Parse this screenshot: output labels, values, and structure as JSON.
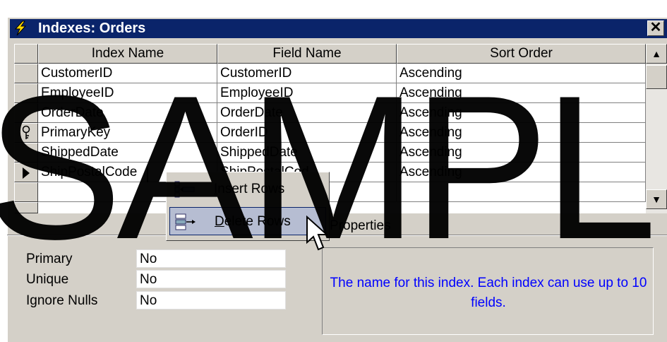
{
  "window": {
    "title": "Indexes: Orders",
    "close_glyph": "✕"
  },
  "grid": {
    "headers": [
      "Index Name",
      "Field Name",
      "Sort Order"
    ],
    "rows": [
      {
        "index": "CustomerID",
        "field": "CustomerID",
        "sort": "Ascending"
      },
      {
        "index": "EmployeeID",
        "field": "EmployeeID",
        "sort": "Ascending"
      },
      {
        "index": "OrderDate",
        "field": "OrderDate",
        "sort": "Ascending"
      },
      {
        "index": "PrimaryKey",
        "field": "OrderID",
        "sort": "Ascending"
      },
      {
        "index": "ShippedDate",
        "field": "ShippedDate",
        "sort": "Ascending"
      },
      {
        "index": "ShipPostalCode",
        "field": "ShipPostalCod",
        "sort": "Ascending"
      }
    ]
  },
  "context_menu": {
    "insert_first": "I",
    "insert_rest": "nsert Rows",
    "delete_first": "D",
    "delete_rest": "elete Rows"
  },
  "properties": {
    "section_label": "Properties",
    "items": [
      {
        "label": "Primary",
        "value": "No"
      },
      {
        "label": "Unique",
        "value": "No"
      },
      {
        "label": "Ignore Nulls",
        "value": "No"
      }
    ],
    "help_text": "The name for this index.  Each index can use up to 10 fields."
  },
  "watermark": "SAMPL",
  "icons": {
    "title": "lightning-bolt-icon",
    "key": "primary-key-icon",
    "row_pointer": "row-pointer-icon",
    "insert": "insert-rows-icon",
    "delete": "delete-rows-icon"
  },
  "colors": {
    "titlebar": "#0a246a",
    "help_text": "#0000ff",
    "menu_highlight": "#b6bdd2"
  }
}
